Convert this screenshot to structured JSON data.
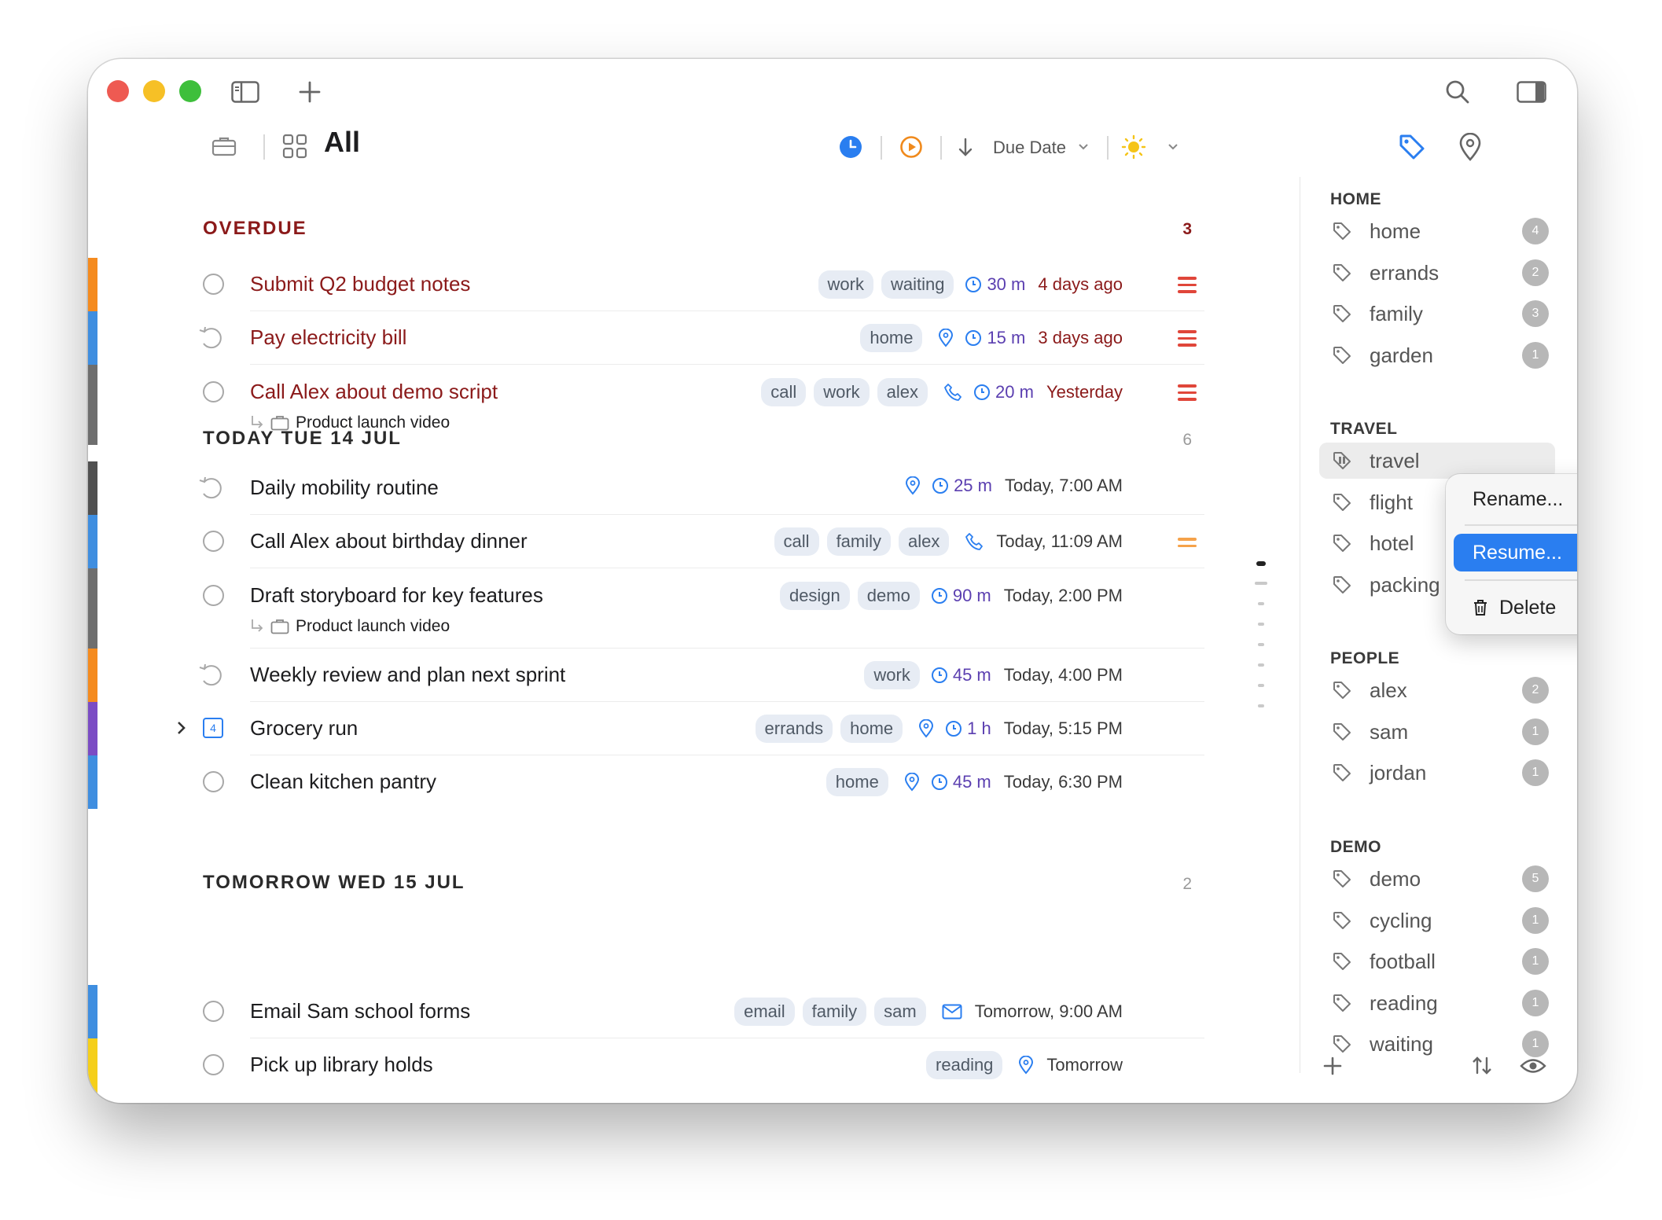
{
  "window": {
    "title": "All",
    "toolbar": {
      "sort_label": "Due Date"
    }
  },
  "colors": {
    "overdue_red": "#8b1a1a",
    "accent_blue": "#2a7ef0",
    "tag_bg": "#e7ecf4",
    "duration_purple": "#5b3fb0"
  },
  "sections": [
    {
      "title": "OVERDUE",
      "count": "3",
      "tasks": [
        {
          "title": "Submit Q2 budget notes",
          "tags": [
            "work",
            "waiting"
          ],
          "duration": "30 m",
          "due": "4 days ago",
          "priority": "high"
        },
        {
          "title": "Pay electricity bill",
          "tags": [
            "home"
          ],
          "duration": "15 m",
          "due": "3 days ago",
          "priority": "high",
          "recurring": true,
          "location": true
        },
        {
          "title": "Call Alex about demo script",
          "tags": [
            "call",
            "work",
            "alex"
          ],
          "duration": "20 m",
          "due": "Yesterday",
          "priority": "high",
          "phone": true,
          "project": "Product launch video"
        }
      ]
    },
    {
      "title": "TODAY TUE 14 JUL",
      "count": "6",
      "tasks": [
        {
          "title": "Daily mobility routine",
          "tags": [],
          "duration": "25 m",
          "due": "Today, 7:00 AM",
          "recurring": true,
          "location": true
        },
        {
          "title": "Call Alex about birthday dinner",
          "tags": [
            "call",
            "family",
            "alex"
          ],
          "due": "Today, 11:09 AM",
          "priority": "medium",
          "phone": true
        },
        {
          "title": "Draft storyboard for key features",
          "tags": [
            "design",
            "demo"
          ],
          "duration": "90 m",
          "due": "Today, 2:00 PM",
          "project": "Product launch video"
        },
        {
          "title": "Weekly review and plan next sprint",
          "tags": [
            "work"
          ],
          "duration": "45 m",
          "due": "Today, 4:00 PM",
          "recurring": true
        },
        {
          "title": "Grocery run",
          "tags": [
            "errands",
            "home"
          ],
          "duration": "1 h",
          "due": "Today, 5:15 PM",
          "location": true,
          "checklist_count": "4"
        },
        {
          "title": "Clean kitchen pantry",
          "tags": [
            "home"
          ],
          "duration": "45 m",
          "due": "Today, 6:30 PM",
          "location": true
        }
      ]
    },
    {
      "title": "TOMORROW WED 15 JUL",
      "count": "2",
      "tasks": [
        {
          "title": "Email Sam school forms",
          "tags": [
            "email",
            "family",
            "sam"
          ],
          "due": "Tomorrow, 9:00 AM",
          "email": true
        },
        {
          "title": "Pick up library holds",
          "tags": [
            "reading"
          ],
          "due": "Tomorrow",
          "location": true
        }
      ]
    }
  ],
  "sidebar": {
    "groups": [
      {
        "title": "HOME",
        "items": [
          {
            "label": "home",
            "count": "4"
          },
          {
            "label": "errands",
            "count": "2"
          },
          {
            "label": "family",
            "count": "3"
          },
          {
            "label": "garden",
            "count": "1"
          }
        ]
      },
      {
        "title": "TRAVEL",
        "items": [
          {
            "label": "travel",
            "count": "",
            "selected": true,
            "paused": true
          },
          {
            "label": "flight",
            "count": ""
          },
          {
            "label": "hotel",
            "count": ""
          },
          {
            "label": "packing",
            "count": ""
          }
        ]
      },
      {
        "title": "PEOPLE",
        "items": [
          {
            "label": "alex",
            "count": "2"
          },
          {
            "label": "sam",
            "count": "1"
          },
          {
            "label": "jordan",
            "count": "1"
          }
        ]
      },
      {
        "title": "DEMO",
        "items": [
          {
            "label": "demo",
            "count": "5"
          },
          {
            "label": "cycling",
            "count": "1"
          },
          {
            "label": "football",
            "count": "1"
          },
          {
            "label": "reading",
            "count": "1"
          },
          {
            "label": "waiting",
            "count": "1"
          }
        ]
      }
    ]
  },
  "context_menu": {
    "rename": "Rename...",
    "resume": "Resume...",
    "delete": "Delete"
  }
}
